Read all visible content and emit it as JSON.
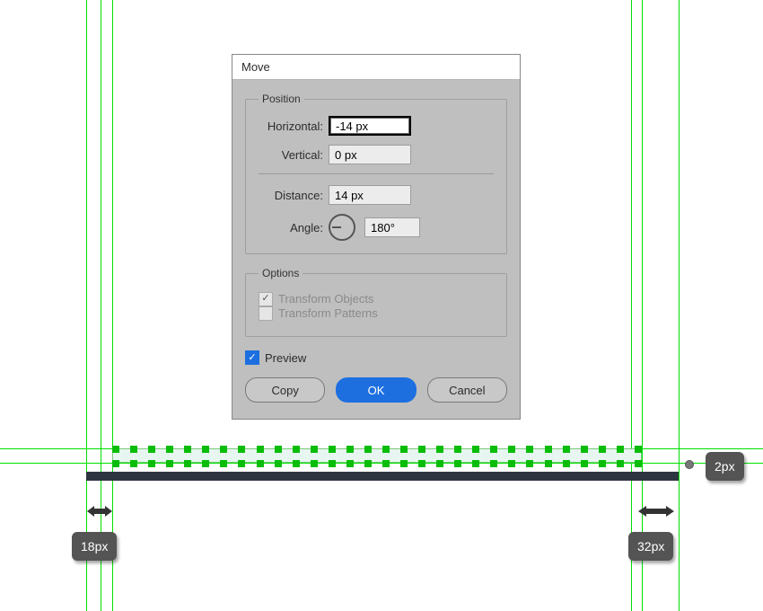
{
  "dialog": {
    "title": "Move",
    "position": {
      "legend": "Position",
      "horizontal_label": "Horizontal:",
      "horizontal_value": "-14 px",
      "vertical_label": "Vertical:",
      "vertical_value": "0 px",
      "distance_label": "Distance:",
      "distance_value": "14 px",
      "angle_label": "Angle:",
      "angle_value": "180°"
    },
    "options": {
      "legend": "Options",
      "transform_objects_label": "Transform Objects",
      "transform_objects_checked": true,
      "transform_patterns_label": "Transform Patterns",
      "transform_patterns_checked": false
    },
    "preview": {
      "label": "Preview",
      "checked": true
    },
    "buttons": {
      "copy": "Copy",
      "ok": "OK",
      "cancel": "Cancel"
    }
  },
  "measurements": {
    "right_gap": "2px",
    "left_inset": "18px",
    "right_inset": "32px"
  },
  "guides": {
    "v": [
      96,
      112,
      125,
      703,
      715,
      756
    ],
    "h": [
      499,
      515
    ]
  }
}
